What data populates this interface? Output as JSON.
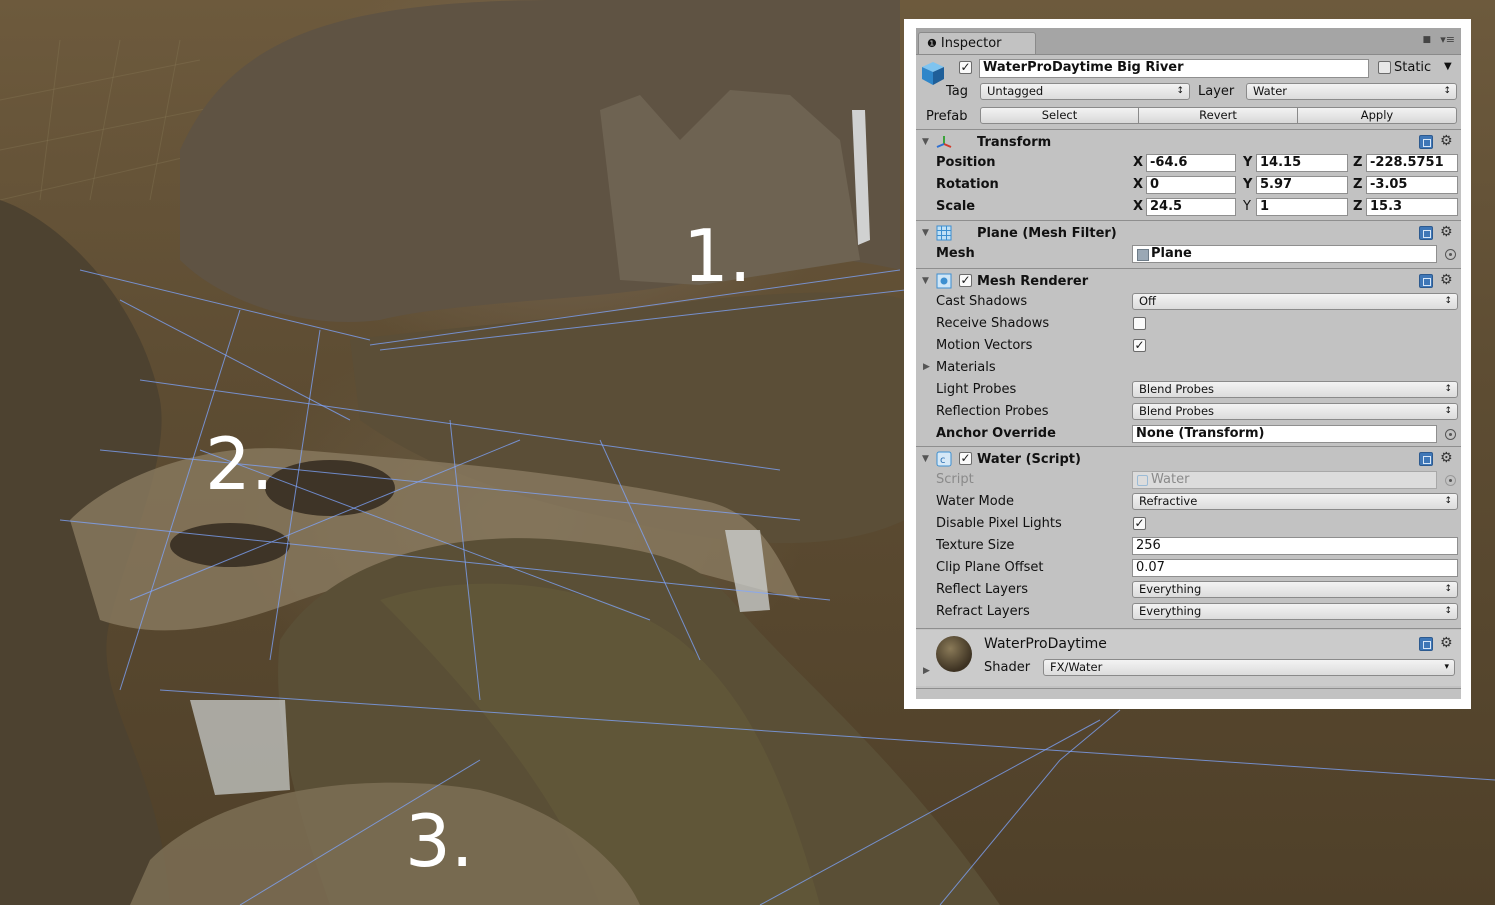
{
  "scene": {
    "labels": [
      "1.",
      "2.",
      "3."
    ]
  },
  "inspector": {
    "tab_title": "Inspector",
    "object": {
      "name": "WaterProDaytime Big River",
      "active": true,
      "static_label": "Static",
      "static_checked": false,
      "tag_label": "Tag",
      "tag_value": "Untagged",
      "layer_label": "Layer",
      "layer_value": "Water",
      "prefab_label": "Prefab",
      "prefab_buttons": [
        "Select",
        "Revert",
        "Apply"
      ]
    },
    "transform": {
      "title": "Transform",
      "position_label": "Position",
      "rotation_label": "Rotation",
      "scale_label": "Scale",
      "axes": [
        "X",
        "Y",
        "Z"
      ],
      "position": [
        "-64.6",
        "14.15",
        "-228.5751"
      ],
      "rotation": [
        "0",
        "5.97",
        "-3.05"
      ],
      "scale": [
        "24.5",
        "1",
        "15.3"
      ]
    },
    "mesh_filter": {
      "title": "Plane (Mesh Filter)",
      "mesh_label": "Mesh",
      "mesh_value": "Plane"
    },
    "mesh_renderer": {
      "title": "Mesh Renderer",
      "enabled": true,
      "cast_shadows_label": "Cast Shadows",
      "cast_shadows_value": "Off",
      "receive_shadows_label": "Receive Shadows",
      "receive_shadows_checked": false,
      "motion_vectors_label": "Motion Vectors",
      "motion_vectors_checked": true,
      "materials_label": "Materials",
      "light_probes_label": "Light Probes",
      "light_probes_value": "Blend Probes",
      "reflection_probes_label": "Reflection Probes",
      "reflection_probes_value": "Blend Probes",
      "anchor_override_label": "Anchor Override",
      "anchor_override_value": "None (Transform)"
    },
    "water_script": {
      "title": "Water (Script)",
      "enabled": true,
      "script_label": "Script",
      "script_value": "Water",
      "water_mode_label": "Water Mode",
      "water_mode_value": "Refractive",
      "disable_pixel_lights_label": "Disable Pixel Lights",
      "disable_pixel_lights_checked": true,
      "texture_size_label": "Texture Size",
      "texture_size_value": "256",
      "clip_plane_offset_label": "Clip Plane Offset",
      "clip_plane_offset_value": "0.07",
      "reflect_layers_label": "Reflect Layers",
      "reflect_layers_value": "Everything",
      "refract_layers_label": "Refract Layers",
      "refract_layers_value": "Everything"
    },
    "material": {
      "name": "WaterProDaytime",
      "shader_label": "Shader",
      "shader_value": "FX/Water"
    }
  },
  "colors": {
    "panel_bg": "#c2c2c2",
    "help_icon": "#3f77b7",
    "scene_label": "#ffffff",
    "grid_line": "#7fa6ff"
  }
}
